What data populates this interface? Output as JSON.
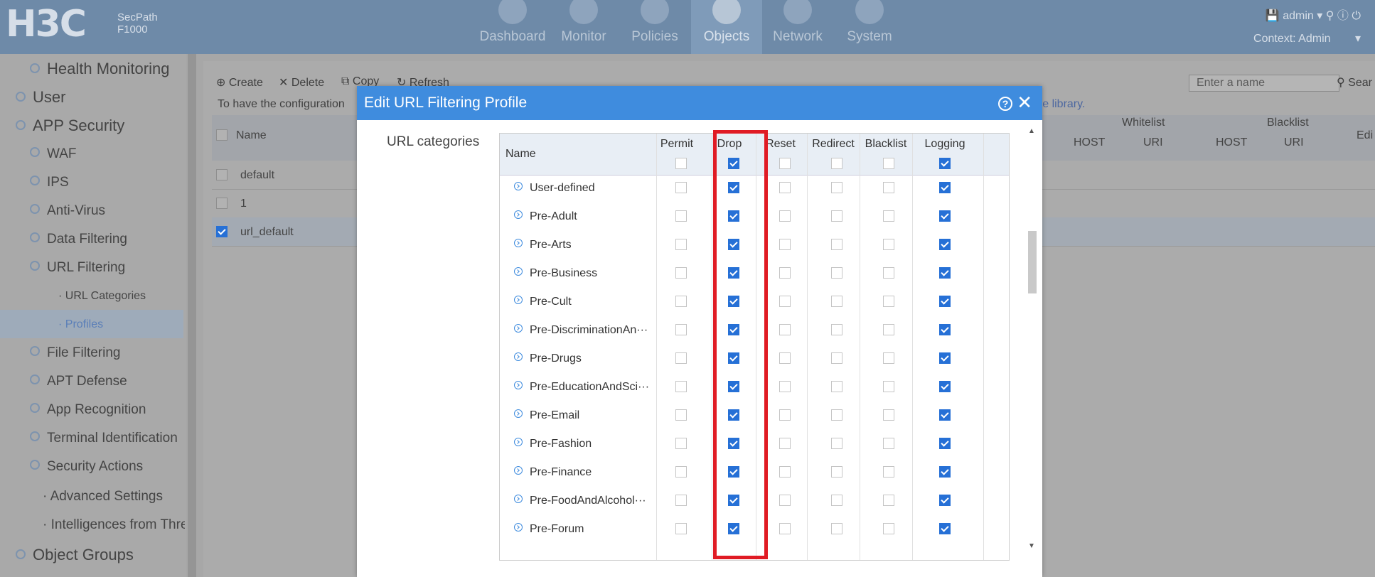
{
  "topbar": {
    "logo": "H3C",
    "product_line1": "SecPath",
    "product_line2": "F1000",
    "nav": [
      {
        "label": "Dashboard",
        "icon": "gauge-icon"
      },
      {
        "label": "Monitor",
        "icon": "monitor-icon"
      },
      {
        "label": "Policies",
        "icon": "shield-icon"
      },
      {
        "label": "Objects",
        "icon": "share-icon",
        "active": true
      },
      {
        "label": "Network",
        "icon": "globe-icon"
      },
      {
        "label": "System",
        "icon": "computer-icon"
      }
    ],
    "user": "admin",
    "context": "Context: Admin"
  },
  "sidebar": {
    "items": [
      {
        "label": "Health Monitoring"
      },
      {
        "label": "User"
      },
      {
        "label": "APP Security"
      },
      {
        "label": "WAF"
      },
      {
        "label": "IPS"
      },
      {
        "label": "Anti-Virus"
      },
      {
        "label": "Data Filtering"
      },
      {
        "label": "URL Filtering"
      },
      {
        "label": "URL Categories"
      },
      {
        "label": "Profiles"
      },
      {
        "label": "File Filtering"
      },
      {
        "label": "APT Defense"
      },
      {
        "label": "App Recognition"
      },
      {
        "label": "Terminal Identification"
      },
      {
        "label": "Security Actions"
      },
      {
        "label": "Advanced Settings"
      },
      {
        "label": "Intelligences from Thre"
      },
      {
        "label": "Object Groups"
      }
    ]
  },
  "toolbar": {
    "create": "Create",
    "delete": "Delete",
    "copy": "Copy",
    "refresh": "Refresh",
    "search_placeholder": "Enter a name",
    "search": "Sear"
  },
  "notice": {
    "left": "To have the configuration",
    "right": "ure library."
  },
  "list": {
    "col_name": "Name",
    "whitelist": "Whitelist",
    "blacklist": "Blacklist",
    "host": "HOST",
    "uri": "URI",
    "edit": "Edi",
    "rows": [
      {
        "name": "default",
        "checked": false
      },
      {
        "name": "1",
        "checked": false
      },
      {
        "name": "url_default",
        "checked": true
      }
    ]
  },
  "dialog": {
    "title": "Edit URL Filtering Profile",
    "section_label": "URL categories",
    "columns": {
      "name": "Name",
      "permit": "Permit",
      "drop": "Drop",
      "reset": "Reset",
      "redirect": "Redirect",
      "blacklist": "Blacklist",
      "logging": "Logging"
    },
    "rows": [
      {
        "name": "User-defined"
      },
      {
        "name": "Pre-Adult"
      },
      {
        "name": "Pre-Arts"
      },
      {
        "name": "Pre-Business"
      },
      {
        "name": "Pre-Cult"
      },
      {
        "name": "Pre-DiscriminationAn···"
      },
      {
        "name": "Pre-Drugs"
      },
      {
        "name": "Pre-EducationAndSci···"
      },
      {
        "name": "Pre-Email"
      },
      {
        "name": "Pre-Fashion"
      },
      {
        "name": "Pre-Finance"
      },
      {
        "name": "Pre-FoodAndAlcohol···"
      },
      {
        "name": "Pre-Forum"
      }
    ]
  }
}
